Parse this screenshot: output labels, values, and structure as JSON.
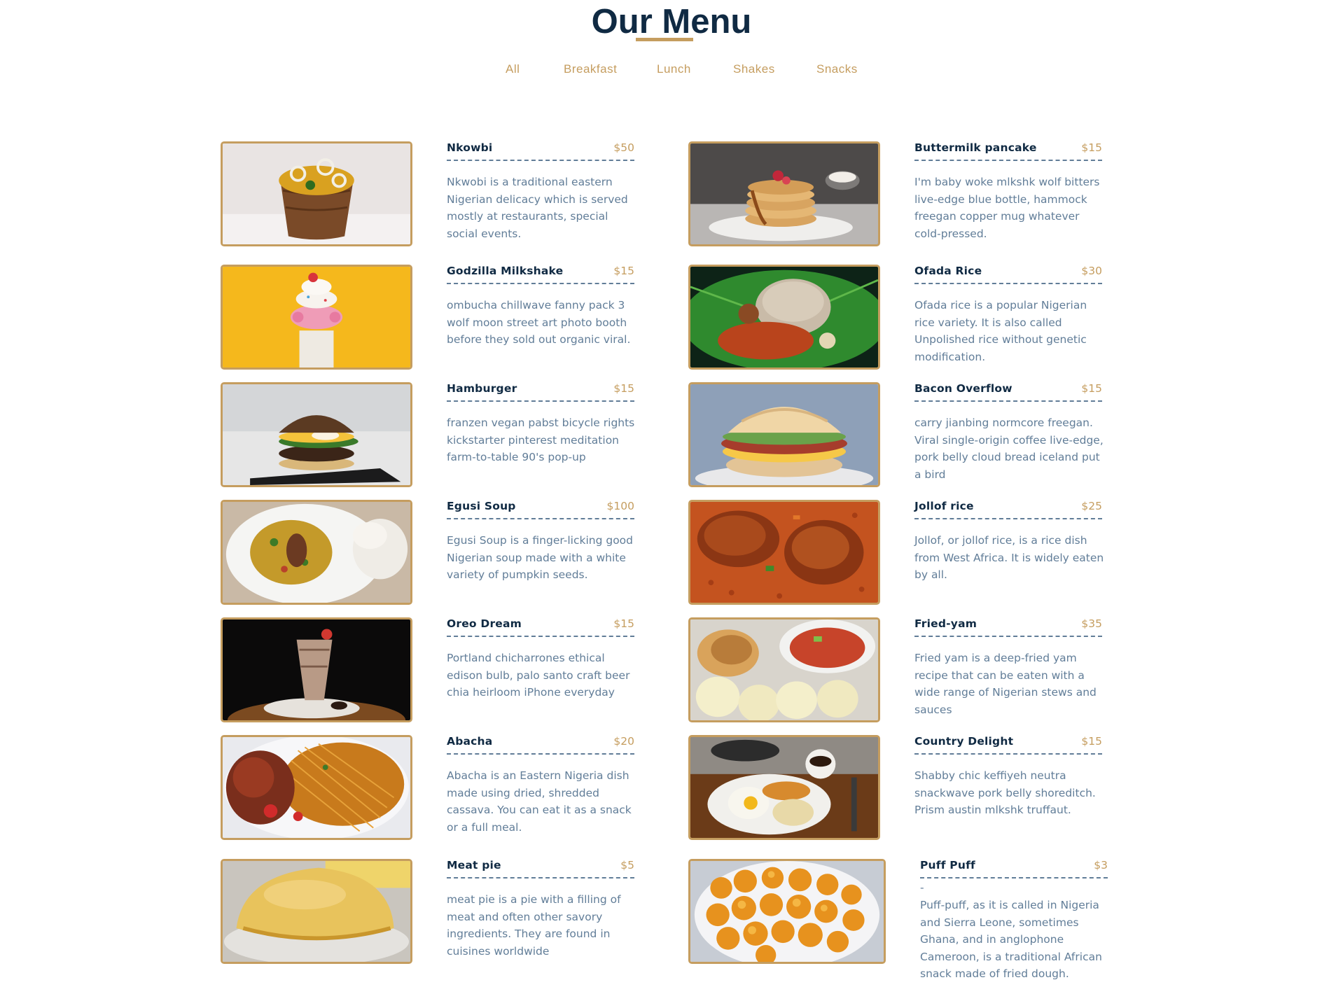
{
  "page": {
    "title": "Our Menu",
    "accent": "#c59d5f",
    "title_color": "#102a43"
  },
  "filters": [
    "All",
    "Breakfast",
    "Lunch",
    "Shakes",
    "Snacks"
  ],
  "items": [
    {
      "name": "Nkowbi",
      "price": "$50",
      "image": "clay-pot-nkwobi",
      "desc": "Nkwobi is a traditional eastern Nigerian delicacy which is served mostly at restaurants, special social events."
    },
    {
      "name": "Buttermilk pancake",
      "price": "$15",
      "image": "pancake-stack",
      "desc": "I'm baby woke mlkshk wolf bitters live-edge blue bottle, hammock freegan copper mug whatever cold-pressed."
    },
    {
      "name": "Godzilla Milkshake",
      "price": "$15",
      "image": "donut-milkshake",
      "desc": "ombucha chillwave fanny pack 3 wolf moon street art photo booth before they sold out organic viral."
    },
    {
      "name": "Ofada Rice",
      "price": "$30",
      "image": "ofada-rice-leaf",
      "desc": "Ofada rice is a popular Nigerian rice variety. It is also called Unpolished rice without genetic modification."
    },
    {
      "name": "Hamburger",
      "price": "$15",
      "image": "hamburger",
      "desc": "franzen vegan pabst bicycle rights kickstarter pinterest meditation farm-to-table 90's pop-up"
    },
    {
      "name": "Bacon Overflow",
      "price": "$15",
      "image": "bacon-biscuit",
      "desc": "carry jianbing normcore freegan. Viral single-origin coffee live-edge, pork belly cloud bread iceland put a bird"
    },
    {
      "name": "Egusi Soup",
      "price": "$100",
      "image": "egusi-soup-plate",
      "desc": "Egusi Soup is a finger-licking good Nigerian soup made with a white variety of pumpkin seeds."
    },
    {
      "name": "Jollof rice",
      "price": "$25",
      "image": "jollof-chicken",
      "desc": "Jollof, or jollof rice, is a rice dish from West Africa. It is widely eaten by all."
    },
    {
      "name": "Oreo Dream",
      "price": "$15",
      "image": "oreo-shake",
      "desc": "Portland chicharrones ethical edison bulb, palo santo craft beer chia heirloom iPhone everyday"
    },
    {
      "name": "Fried-yam",
      "price": "$35",
      "image": "fried-yam-stew",
      "desc": "Fried yam is a deep-fried yam recipe that can be eaten with a wide range of Nigerian stews and sauces"
    },
    {
      "name": "Abacha",
      "price": "$20",
      "image": "abacha-fish",
      "desc": "Abacha is an Eastern Nigeria dish made using dried, shredded cassava. You can eat it as a snack or a full meal."
    },
    {
      "name": "Country Delight",
      "price": "$15",
      "image": "breakfast-eggs",
      "desc": "Shabby chic keffiyeh neutra snackwave pork belly shoreditch. Prism austin mlkshk truffaut."
    },
    {
      "name": "Meat pie",
      "price": "$5",
      "image": "meat-pie",
      "desc": "meat pie is a pie with a filling of meat and often other savory ingredients. They are found in cuisines worldwide"
    },
    {
      "name": "Puff Puff",
      "price": "$3",
      "image": "puff-puff-balls",
      "dash": "-",
      "desc": "Puff-puff, as it is called in Nigeria and Sierra Leone, sometimes Ghana, and in anglophone Cameroon, is a traditional African snack made of fried dough."
    }
  ]
}
